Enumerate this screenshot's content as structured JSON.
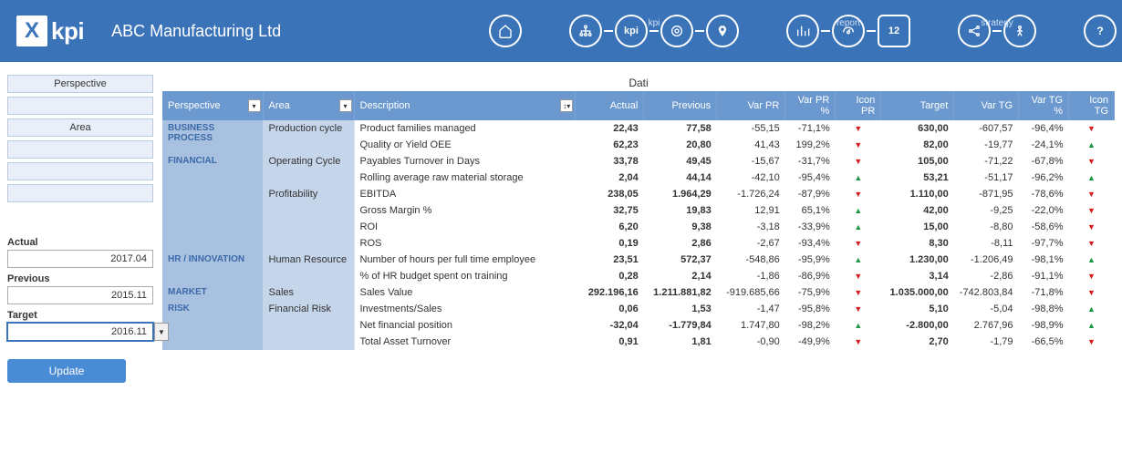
{
  "header": {
    "logo_text": "kpi",
    "company": "ABC Manufacturing Ltd",
    "nav_labels": {
      "kpi": "kpi",
      "report": "report",
      "strategy": "strategy"
    },
    "kpi_text": "kpi",
    "cal_text": "12"
  },
  "sidebar": {
    "perspective_label": "Perspective",
    "area_label": "Area",
    "actual_label": "Actual",
    "actual_value": "2017.04",
    "previous_label": "Previous",
    "previous_value": "2015.11",
    "target_label": "Target",
    "target_value": "2016.11",
    "update_label": "Update"
  },
  "table": {
    "title": "Dati",
    "headers": {
      "perspective": "Perspective",
      "area": "Area",
      "description": "Description",
      "actual": "Actual",
      "previous": "Previous",
      "var_pr": "Var PR",
      "var_pr_pct": "Var PR %",
      "icon_pr": "Icon PR",
      "target": "Target",
      "var_tg": "Var TG",
      "var_tg_pct": "Var TG %",
      "icon_tg": "Icon TG"
    },
    "rows": [
      {
        "perspective": "BUSINESS PROCESS",
        "area": "Production cycle",
        "desc": "Product families managed",
        "actual": "22,43",
        "previous": "77,58",
        "var_pr": "-55,15",
        "var_pr_pct": "-71,1%",
        "icon_pr": "dn",
        "target": "630,00",
        "var_tg": "-607,57",
        "var_tg_pct": "-96,4%",
        "icon_tg": "dn"
      },
      {
        "perspective": "",
        "area": "",
        "desc": "Quality or Yield OEE",
        "actual": "62,23",
        "previous": "20,80",
        "var_pr": "41,43",
        "var_pr_pct": "199,2%",
        "icon_pr": "dn",
        "target": "82,00",
        "var_tg": "-19,77",
        "var_tg_pct": "-24,1%",
        "icon_tg": "up"
      },
      {
        "perspective": "FINANCIAL",
        "area": "Operating Cycle",
        "desc": "Payables Turnover in Days",
        "actual": "33,78",
        "previous": "49,45",
        "var_pr": "-15,67",
        "var_pr_pct": "-31,7%",
        "icon_pr": "dn",
        "target": "105,00",
        "var_tg": "-71,22",
        "var_tg_pct": "-67,8%",
        "icon_tg": "dn"
      },
      {
        "perspective": "",
        "area": "",
        "desc": "Rolling average raw material storage",
        "actual": "2,04",
        "previous": "44,14",
        "var_pr": "-42,10",
        "var_pr_pct": "-95,4%",
        "icon_pr": "up",
        "target": "53,21",
        "var_tg": "-51,17",
        "var_tg_pct": "-96,2%",
        "icon_tg": "up"
      },
      {
        "perspective": "",
        "area": "Profitability",
        "desc": "EBITDA",
        "actual": "238,05",
        "previous": "1.964,29",
        "var_pr": "-1.726,24",
        "var_pr_pct": "-87,9%",
        "icon_pr": "dn",
        "target": "1.110,00",
        "var_tg": "-871,95",
        "var_tg_pct": "-78,6%",
        "icon_tg": "dn"
      },
      {
        "perspective": "",
        "area": "",
        "desc": "Gross Margin %",
        "actual": "32,75",
        "previous": "19,83",
        "var_pr": "12,91",
        "var_pr_pct": "65,1%",
        "icon_pr": "up",
        "target": "42,00",
        "var_tg": "-9,25",
        "var_tg_pct": "-22,0%",
        "icon_tg": "dn"
      },
      {
        "perspective": "",
        "area": "",
        "desc": "ROI",
        "actual": "6,20",
        "previous": "9,38",
        "var_pr": "-3,18",
        "var_pr_pct": "-33,9%",
        "icon_pr": "up",
        "target": "15,00",
        "var_tg": "-8,80",
        "var_tg_pct": "-58,6%",
        "icon_tg": "dn"
      },
      {
        "perspective": "",
        "area": "",
        "desc": "ROS",
        "actual": "0,19",
        "previous": "2,86",
        "var_pr": "-2,67",
        "var_pr_pct": "-93,4%",
        "icon_pr": "dn",
        "target": "8,30",
        "var_tg": "-8,11",
        "var_tg_pct": "-97,7%",
        "icon_tg": "dn"
      },
      {
        "perspective": "HR / INNOVATION",
        "area": "Human Resource",
        "desc": "Number of hours per full time employee",
        "actual": "23,51",
        "previous": "572,37",
        "var_pr": "-548,86",
        "var_pr_pct": "-95,9%",
        "icon_pr": "up",
        "target": "1.230,00",
        "var_tg": "-1.206,49",
        "var_tg_pct": "-98,1%",
        "icon_tg": "up"
      },
      {
        "perspective": "",
        "area": "",
        "desc": "% of HR budget spent on training",
        "actual": "0,28",
        "previous": "2,14",
        "var_pr": "-1,86",
        "var_pr_pct": "-86,9%",
        "icon_pr": "dn",
        "target": "3,14",
        "var_tg": "-2,86",
        "var_tg_pct": "-91,1%",
        "icon_tg": "dn"
      },
      {
        "perspective": "MARKET",
        "area": "Sales",
        "desc": "Sales Value",
        "actual": "292.196,16",
        "previous": "1.211.881,82",
        "var_pr": "-919.685,66",
        "var_pr_pct": "-75,9%",
        "icon_pr": "dn",
        "target": "1.035.000,00",
        "var_tg": "-742.803,84",
        "var_tg_pct": "-71,8%",
        "icon_tg": "dn"
      },
      {
        "perspective": "RISK",
        "area": "Financial Risk",
        "desc": "Investments/Sales",
        "actual": "0,06",
        "previous": "1,53",
        "var_pr": "-1,47",
        "var_pr_pct": "-95,8%",
        "icon_pr": "dn",
        "target": "5,10",
        "var_tg": "-5,04",
        "var_tg_pct": "-98,8%",
        "icon_tg": "up"
      },
      {
        "perspective": "",
        "area": "",
        "desc": "Net financial position",
        "actual": "-32,04",
        "previous": "-1.779,84",
        "var_pr": "1.747,80",
        "var_pr_pct": "-98,2%",
        "icon_pr": "up",
        "target": "-2.800,00",
        "var_tg": "2.767,96",
        "var_tg_pct": "-98,9%",
        "icon_tg": "up"
      },
      {
        "perspective": "",
        "area": "",
        "desc": "Total Asset Turnover",
        "actual": "0,91",
        "previous": "1,81",
        "var_pr": "-0,90",
        "var_pr_pct": "-49,9%",
        "icon_pr": "dn",
        "target": "2,70",
        "var_tg": "-1,79",
        "var_tg_pct": "-66,5%",
        "icon_tg": "dn"
      }
    ]
  }
}
